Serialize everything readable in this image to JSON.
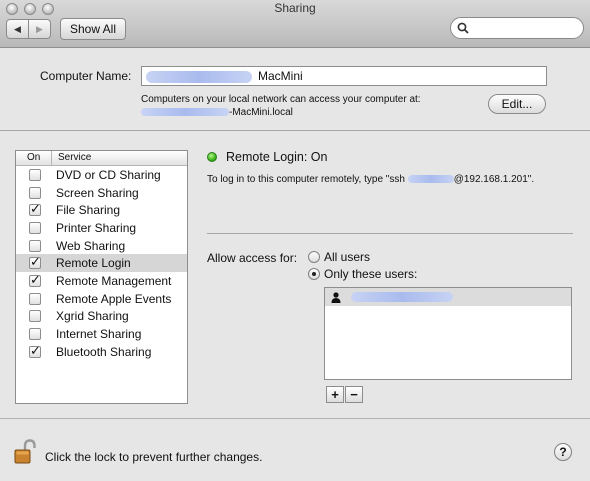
{
  "window": {
    "title": "Sharing"
  },
  "toolbar": {
    "back_icon": "◀",
    "forward_icon": "▶",
    "show_all_label": "Show All",
    "search_value": ""
  },
  "computer_name": {
    "label": "Computer Name:",
    "value_visible": "MacMini",
    "info_line1": "Computers on your local network can access your computer at:",
    "info_line2": "-MacMini.local",
    "edit_label": "Edit..."
  },
  "services": {
    "header_on": "On",
    "header_service": "Service",
    "items": [
      {
        "label": "DVD or CD Sharing",
        "checked": false
      },
      {
        "label": "Screen Sharing",
        "checked": false
      },
      {
        "label": "File Sharing",
        "checked": true
      },
      {
        "label": "Printer Sharing",
        "checked": false
      },
      {
        "label": "Web Sharing",
        "checked": false
      },
      {
        "label": "Remote Login",
        "checked": true,
        "selected": true
      },
      {
        "label": "Remote Management",
        "checked": true
      },
      {
        "label": "Remote Apple Events",
        "checked": false
      },
      {
        "label": "Xgrid Sharing",
        "checked": false
      },
      {
        "label": "Internet Sharing",
        "checked": false
      },
      {
        "label": "Bluetooth Sharing",
        "checked": true
      }
    ]
  },
  "detail": {
    "status": "Remote Login: On",
    "status_color": "#3bb51a",
    "instruction_prefix": "To log in to this computer remotely, type \"ssh ",
    "instruction_suffix": "@192.168.1.201\".",
    "allow_label": "Allow access for:",
    "option_all": "All users",
    "option_only": "Only these users:",
    "selected_option": "only"
  },
  "users_list": {
    "add_label": "+",
    "remove_label": "−"
  },
  "footer": {
    "lock_text": "Click the lock to prevent further changes.",
    "help_label": "?"
  }
}
